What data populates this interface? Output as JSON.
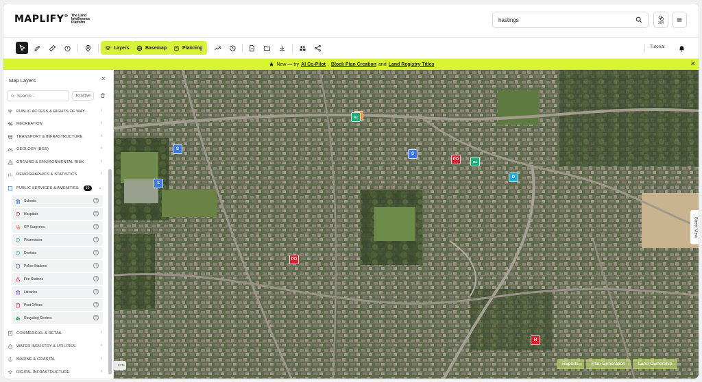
{
  "header": {
    "logo_text": "MAPLIFY",
    "logo_reg": "®",
    "logo_tagline": "The Land Intelligence Platform",
    "search_value": "hastings",
    "credits_count": "364"
  },
  "toolbar": {
    "layers_label": "Layers",
    "basemap_label": "Basemap",
    "planning_label": "Planning",
    "tutorial_label": "Tutorial"
  },
  "banner": {
    "prefix": "New — try",
    "link1": "AI Co-Pilot",
    "sep1": ",",
    "link2": "Block Plan Creation",
    "sep2": "and",
    "link3": "Land Registry Titles"
  },
  "sidebar": {
    "title": "Map Layers",
    "search_placeholder": "Search...",
    "active_badge": "10 active",
    "categories_top": [
      {
        "label": "PUBLIC ACCESS & RIGHTS OF WAY",
        "icon": "signpost-icon"
      },
      {
        "label": "RECREATION",
        "icon": "trees-icon"
      },
      {
        "label": "TRANSPORT & INFRASTRUCTURE",
        "icon": "bus-icon"
      },
      {
        "label": "GEOLOGY (BGS)",
        "icon": "mountain-icon"
      },
      {
        "label": "GROUND & ENVIRONMENTAL RISK",
        "icon": "warning-icon"
      },
      {
        "label": "DEMOGRAPHICS & STATISTICS",
        "icon": "bar-chart-icon"
      }
    ],
    "expanded_category": {
      "label": "PUBLIC SERVICES & AMENITIES",
      "count": "10"
    },
    "sub_items": [
      {
        "label": "Schools",
        "color": "#3b78e0"
      },
      {
        "label": "Hospitals",
        "color": "#d3212d"
      },
      {
        "label": "GP Surgeries",
        "color": "#e5672a"
      },
      {
        "label": "Pharmacies",
        "color": "#1fae7a"
      },
      {
        "label": "Dentists",
        "color": "#24a9d6"
      },
      {
        "label": "Police Stations",
        "color": "#3a4fb5"
      },
      {
        "label": "Fire Stations",
        "color": "#d3212d"
      },
      {
        "label": "Libraries",
        "color": "#8c4fd1"
      },
      {
        "label": "Post Offices",
        "color": "#d3212d"
      },
      {
        "label": "Recycling Centers",
        "color": "#1f9a4a"
      }
    ],
    "categories_bottom": [
      {
        "label": "COMMERCIAL & RETAIL",
        "icon": "building-icon"
      },
      {
        "label": "WATER INDUSTRY & UTILITIES",
        "icon": "droplet-icon"
      },
      {
        "label": "MARINE & COASTAL",
        "icon": "anchor-icon"
      },
      {
        "label": "DIGITAL INFRASTRUCTURE",
        "icon": "wifi-icon"
      }
    ]
  },
  "map": {
    "markers": [
      {
        "label": "Rx",
        "kind": "pharmacy",
        "color": "#1fae7a"
      },
      {
        "label": "S",
        "kind": "school",
        "color": "#3b78e0"
      },
      {
        "label": "S",
        "kind": "school",
        "color": "#3b78e0"
      },
      {
        "label": "S",
        "kind": "school",
        "color": "#3b78e0"
      },
      {
        "label": "PO",
        "kind": "post-office",
        "color": "#d3212d"
      },
      {
        "label": "Rx",
        "kind": "pharmacy",
        "color": "#1fae7a"
      },
      {
        "label": "D",
        "kind": "dentist",
        "color": "#24a9d6"
      },
      {
        "label": "PO",
        "kind": "post-office",
        "color": "#d3212d"
      },
      {
        "label": "H",
        "kind": "hospital",
        "color": "#d3212d"
      }
    ],
    "street_view_label": "Street View",
    "collapsed_tab_label": "ects",
    "bottom_tabs": [
      "Reports",
      "Plan Generation",
      "Land Ownership"
    ]
  }
}
